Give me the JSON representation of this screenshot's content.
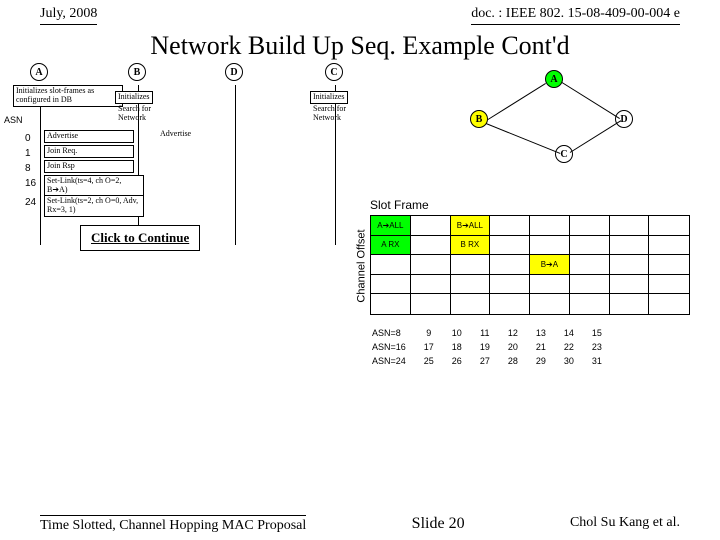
{
  "header": {
    "date": "July, 2008",
    "doc": "doc. : IEEE 802. 15-08-409-00-004 e"
  },
  "title": "Network Build Up Seq. Example Cont'd",
  "nodes": {
    "a": "A",
    "b": "B",
    "d": "D",
    "c": "C"
  },
  "seq": {
    "init_sf": "Initializes slot-frames as configured in DB",
    "init": "Initializes",
    "search": "Search for Network",
    "asn_label": "ASN",
    "asn_values": [
      "0",
      "1",
      "8",
      "16",
      "24"
    ],
    "events": {
      "advertise": "Advertise",
      "join_req": "Join Req.",
      "join_rsp": "Join Rsp",
      "set_link1": "Set-Link(ts=4, ch O=2, B➔A)",
      "set_link2": "Set-Link(ts=2, ch O=0, Adv, Rx=3, 1)"
    }
  },
  "click_btn": "Click to Continue",
  "slotframe": {
    "title": "Slot Frame",
    "ch_offset": "Channel Offset",
    "cells": {
      "a_all": "A➔ALL",
      "a_rx": "A RX",
      "b_all": "B➔ALL",
      "b_rx": "B RX",
      "b_a": "B➔A"
    }
  },
  "asn_table": {
    "rows": [
      {
        "label": "ASN=8",
        "vals": [
          "9",
          "10",
          "11",
          "12",
          "13",
          "14",
          "15"
        ]
      },
      {
        "label": "ASN=16",
        "vals": [
          "17",
          "18",
          "19",
          "20",
          "21",
          "22",
          "23"
        ]
      },
      {
        "label": "ASN=24",
        "vals": [
          "25",
          "26",
          "27",
          "28",
          "29",
          "30",
          "31"
        ]
      }
    ]
  },
  "footer": {
    "left": "Time Slotted, Channel Hopping MAC Proposal",
    "center": "Slide 20",
    "right": "Chol Su Kang et al."
  }
}
